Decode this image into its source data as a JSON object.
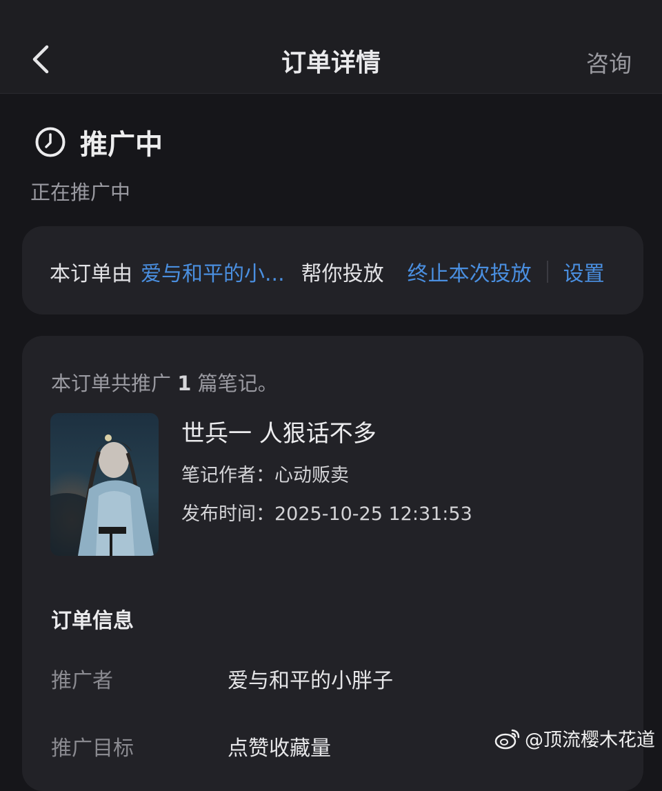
{
  "nav": {
    "title": "订单详情",
    "consult": "咨询"
  },
  "status": {
    "title": "推广中",
    "subtitle": "正在推广中"
  },
  "delegation": {
    "prefix": "本订单由",
    "user": "爱与和平的小...",
    "suffix": "帮你投放",
    "stop": "终止本次投放",
    "settings": "设置"
  },
  "notes": {
    "summary_prefix": "本订单共推广",
    "count": "1",
    "summary_suffix": "篇笔记。",
    "item": {
      "title": "世兵一 人狠话不多",
      "author_label": "笔记作者：",
      "author": "心动贩卖",
      "time_label": "发布时间：",
      "time": "2025-10-25 12:31:53"
    }
  },
  "order_info": {
    "title": "订单信息",
    "rows": [
      {
        "label": "推广者",
        "value": "爱与和平的小胖子"
      },
      {
        "label": "推广目标",
        "value": "点赞收藏量"
      }
    ]
  },
  "watermark": {
    "text": "@顶流樱木花道"
  },
  "icons": [
    "back-icon",
    "clock-icon",
    "weibo-icon"
  ]
}
